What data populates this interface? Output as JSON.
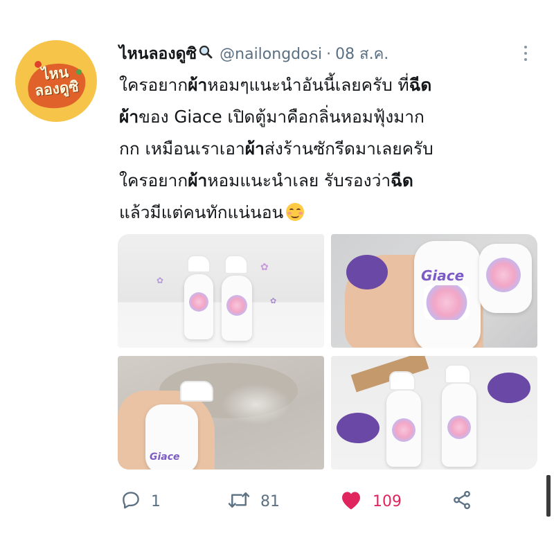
{
  "tweet": {
    "author_name": "ไหนลองดูซิ",
    "author_handle": "@nailongdosi",
    "separator": "·",
    "date": "08 ส.ค.",
    "avatar_text_line1": "ไหน",
    "avatar_text_line2": "ลองดูซิ",
    "body": [
      [
        {
          "t": "ใครอยาก",
          "b": false
        },
        {
          "t": "ผ้า",
          "b": true
        },
        {
          "t": "หอมๆแนะนำอันนี้เลยครับ ที่",
          "b": false
        },
        {
          "t": "ฉีด",
          "b": true
        }
      ],
      [
        {
          "t": "ผ้า",
          "b": true
        },
        {
          "t": "ของ Giace เปิดตู้มาคือกลิ่นหอมฟุ้งมาก",
          "b": false
        }
      ],
      [
        {
          "t": "กก เหมือนเราเอา",
          "b": false
        },
        {
          "t": "ผ้า",
          "b": true
        },
        {
          "t": "ส่งร้านซักรีดมาเลยครับ",
          "b": false
        }
      ],
      [
        {
          "t": "ใครอยาก",
          "b": false
        },
        {
          "t": "ผ้า",
          "b": true
        },
        {
          "t": "หอมแนะนำเลย รับรองว่า",
          "b": false
        },
        {
          "t": "ฉีด",
          "b": true
        }
      ],
      [
        {
          "t": "แล้วมีแต่คนทักแน่นอน",
          "b": false
        }
      ]
    ],
    "emoji": "smiling-face-with-smiling-eyes",
    "product_brand": "Giace",
    "actions": {
      "replies": "1",
      "retweets": "81",
      "likes": "109"
    }
  },
  "colors": {
    "text": "#14171a",
    "secondary": "#5b7083",
    "like": "#e0245e",
    "avatar_bg": "#f7c44a"
  },
  "icons": {
    "search": "magnifier-icon",
    "more": "more-vertical-icon",
    "reply": "reply-icon",
    "retweet": "retweet-icon",
    "like": "heart-icon",
    "share": "share-icon"
  }
}
